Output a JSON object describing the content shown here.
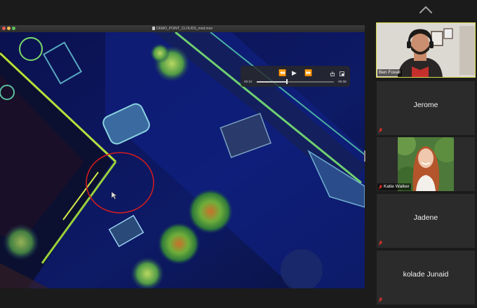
{
  "top": {
    "collapse_icon": "chevron-up-icon"
  },
  "share": {
    "window_title": "DEMO_POINT_CLOUDS_mod.mov",
    "player": {
      "elapsed": "00:10",
      "remaining": "-00:36"
    }
  },
  "participants": [
    {
      "name": "Ben Foxall",
      "video": true,
      "muted": false,
      "active_speaker": true
    },
    {
      "name": "Jerome",
      "video": false,
      "muted": true
    },
    {
      "name": "Katie Walker",
      "video": true,
      "muted": true
    },
    {
      "name": "Jadene",
      "video": false,
      "muted": true
    },
    {
      "name": "kolade Junaid",
      "video": false,
      "muted": true
    }
  ],
  "colors": {
    "active_outline": "#d6d94a",
    "muted_red": "#e0302a",
    "annotation_circle": "#d81c1c",
    "tile_bg": "#2b2b2b"
  }
}
